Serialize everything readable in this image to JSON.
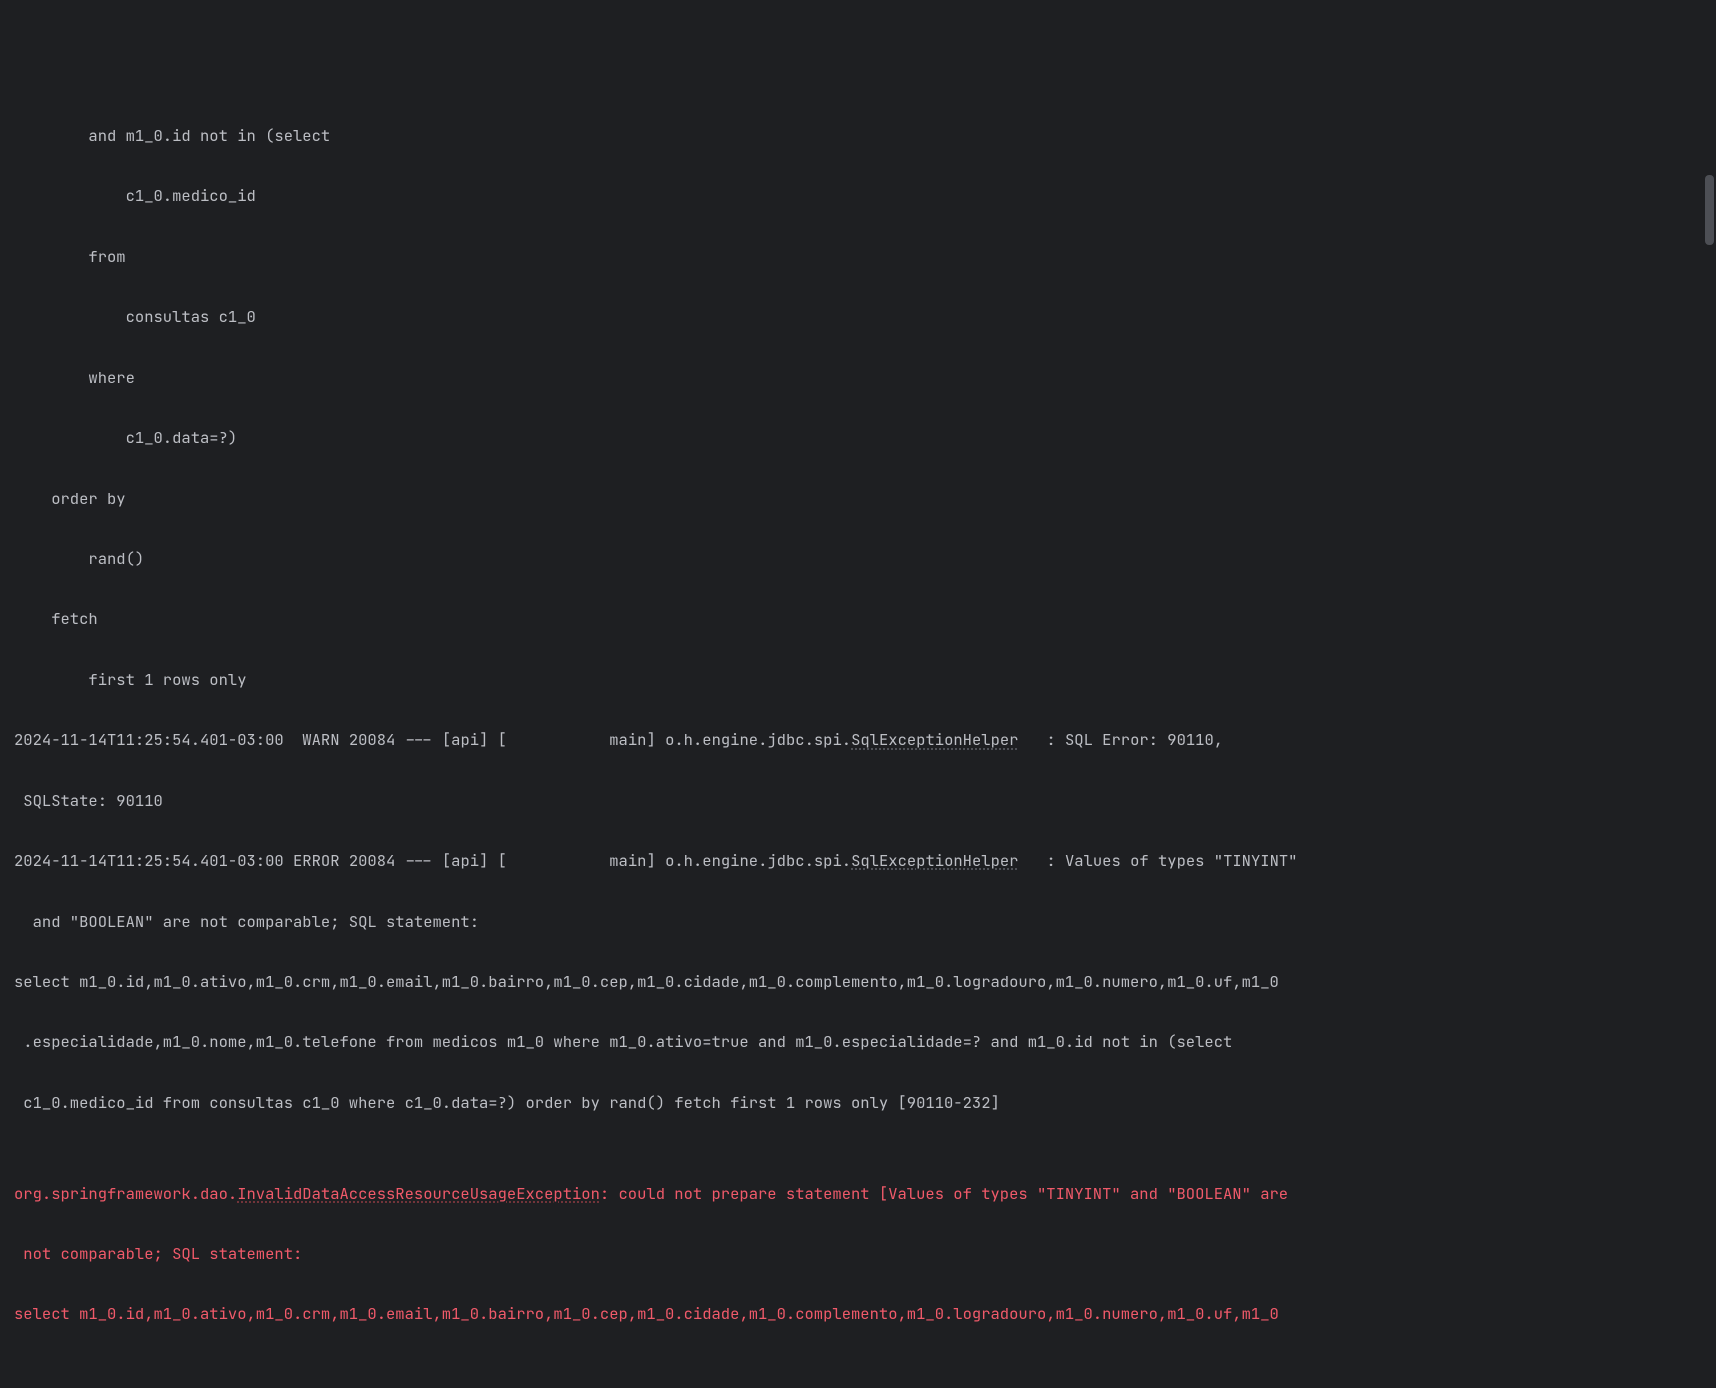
{
  "sql_fragment": {
    "l1": "        and m1_0.id not in (select",
    "l2": "            c1_0.medico_id ",
    "l3": "        from",
    "l4": "            consultas c1_0 ",
    "l5": "        where",
    "l6": "            c1_0.data=?) ",
    "l7": "    order by",
    "l8": "        rand() ",
    "l9": "    fetch",
    "l10": "        first 1 rows only"
  },
  "warn": {
    "timestamp": "2024-11-14T11:25:54.401-03:00",
    "level": "  WARN ",
    "pid": "20084",
    "sep": " --- ",
    "app": "[api] ",
    "thread": "[           main] ",
    "logger_pre": "o.h.engine.jdbc.spi.",
    "logger_u": "SqlExceptionHelper",
    "msg_head": "   : SQL Error: 90110,",
    "msg_wrap": " SQLState: 90110"
  },
  "err": {
    "timestamp": "2024-11-14T11:25:54.401-03:00",
    "level": " ERROR ",
    "pid": "20084",
    "sep": " --- ",
    "app": "[api] ",
    "thread": "[           main] ",
    "logger_pre": "o.h.engine.jdbc.spi.",
    "logger_u": "SqlExceptionHelper",
    "msg_head": "   : Values of types \"TINYINT\"",
    "msg_wrap": "  and \"BOOLEAN\" are not comparable; SQL statement:"
  },
  "stmt": {
    "l1": "select m1_0.id,m1_0.ativo,m1_0.crm,m1_0.email,m1_0.bairro,m1_0.cep,m1_0.cidade,m1_0.complemento,m1_0.logradouro,m1_0.numero,m1_0.uf,m1_0",
    "l2": " .especialidade,m1_0.nome,m1_0.telefone from medicos m1_0 where m1_0.ativo=true and m1_0.especialidade=? and m1_0.id not in (select ",
    "l3": " c1_0.medico_id from consultas c1_0 where c1_0.data=?) order by rand() fetch first 1 rows only [90110-232]"
  },
  "blank": "",
  "exc": {
    "pkg": "org.springframework.dao.",
    "cls": "InvalidDataAccessResourceUsageException",
    "msg1": ": could not prepare statement [Values of types \"TINYINT\" and \"BOOLEAN\" are",
    "msg1_wrap": " not comparable; SQL statement:",
    "msg2": "select m1_0.id,m1_0.ativo,m1_0.crm,m1_0.email,m1_0.bairro,m1_0.cep,m1_0.cidade,m1_0.complemento,m1_0.logradouro,m1_0.numero,m1_0.uf,m1_0"
  }
}
